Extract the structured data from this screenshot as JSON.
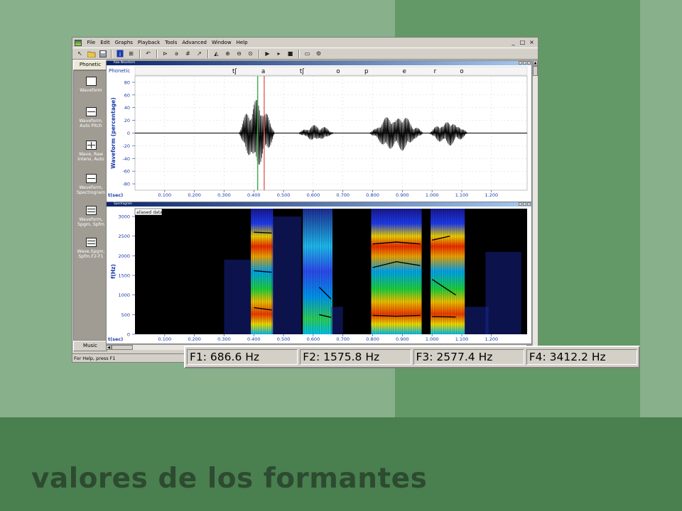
{
  "slide": {
    "caption": "valores de los formantes"
  },
  "app": {
    "menu": [
      "File",
      "Edit",
      "Graphs",
      "Playback",
      "Tools",
      "Advanced",
      "Window",
      "Help"
    ],
    "window_controls": [
      "_",
      "□",
      "×"
    ],
    "status_text": "For Help, press F1"
  },
  "sidebar": {
    "top_tab": "Phonetic",
    "bottom_tab": "Music",
    "layouts": [
      {
        "label": "Waveform"
      },
      {
        "label": "Waveform, Auto Pitch"
      },
      {
        "label": "Wave, Raw Intens, Auto"
      },
      {
        "label": "Waveform, Spectrogram"
      },
      {
        "label": "Waveform, Spgm, Spfm"
      },
      {
        "label": "Wave,Spgm, Spfm,F2-F1"
      }
    ]
  },
  "waveform_panel": {
    "window_title": "Raw Waveform",
    "tier_label": "Phonetic",
    "phonetic_symbols": [
      {
        "t": 0.335,
        "s": "tʃ"
      },
      {
        "t": 0.432,
        "s": "a"
      },
      {
        "t": 0.562,
        "s": "tʃ"
      },
      {
        "t": 0.684,
        "s": "o"
      },
      {
        "t": 0.779,
        "s": "p"
      },
      {
        "t": 0.907,
        "s": "e"
      },
      {
        "t": 1.01,
        "s": "r"
      },
      {
        "t": 1.1,
        "s": "o"
      }
    ],
    "cursor_green_t": 0.413,
    "cursor_red_t": 0.435
  },
  "spectrogram_panel": {
    "window_title": "Spectrogram",
    "overlay_label": "aliased data"
  },
  "formants": [
    {
      "label": "F1: 686.6 Hz",
      "hz": 686.6
    },
    {
      "label": "F2: 1575.8 Hz",
      "hz": 1575.8
    },
    {
      "label": "F3: 2577.4 Hz",
      "hz": 2577.4
    },
    {
      "label": "F4: 3412.2 Hz",
      "hz": 3412.2
    }
  ],
  "chart_data": [
    {
      "type": "line",
      "ylabel": "Waveform (percentage)",
      "xlabel": "t(sec)",
      "ylim": [
        -90,
        90
      ],
      "xlim": [
        0.0,
        1.32
      ],
      "y_ticks": [
        80,
        60,
        40,
        20,
        0,
        -20,
        -40,
        -60,
        -80
      ],
      "x_ticks": [
        "0.100",
        "0.200",
        "0.300",
        "0.400",
        "0.500",
        "0.600",
        "0.700",
        "0.800",
        "0.900",
        "1.000",
        "1.100",
        "1.200"
      ],
      "grid": true,
      "series": [
        {
          "segments": [
            {
              "t0": 0.35,
              "t1": 0.47,
              "amp": 55
            },
            {
              "t0": 0.55,
              "t1": 0.67,
              "amp": 13
            },
            {
              "t0": 0.79,
              "t1": 0.97,
              "amp": 30
            },
            {
              "t0": 0.99,
              "t1": 1.12,
              "amp": 20
            }
          ]
        }
      ]
    },
    {
      "type": "heatmap",
      "ylabel": "f(Hz)",
      "xlabel": "t(sec)",
      "ylim": [
        0,
        3200
      ],
      "xlim": [
        0.0,
        1.32
      ],
      "y_ticks": [
        3000,
        2500,
        2000,
        1500,
        1000,
        500,
        0
      ],
      "x_ticks": [
        "0.100",
        "0.200",
        "0.300",
        "0.400",
        "0.500",
        "0.600",
        "0.700",
        "0.800",
        "0.900",
        "1.000",
        "1.100",
        "1.200"
      ],
      "energy_regions": [
        {
          "t0": 0.39,
          "t1": 0.465,
          "f0": 0,
          "f1": 3200
        },
        {
          "t0": 0.565,
          "t1": 0.665,
          "f0": 0,
          "f1": 3200
        },
        {
          "t0": 0.795,
          "t1": 0.965,
          "f0": 0,
          "f1": 3200
        },
        {
          "t0": 0.995,
          "t1": 1.11,
          "f0": 0,
          "f1": 3200
        }
      ],
      "formant_tracks": [
        {
          "points": [
            [
              0.4,
              2600
            ],
            [
              0.46,
              2580
            ]
          ]
        },
        {
          "points": [
            [
              0.4,
              1620
            ],
            [
              0.46,
              1580
            ]
          ]
        },
        {
          "points": [
            [
              0.4,
              680
            ],
            [
              0.46,
              620
            ]
          ]
        },
        {
          "points": [
            [
              0.62,
              1200
            ],
            [
              0.66,
              900
            ]
          ]
        },
        {
          "points": [
            [
              0.62,
              500
            ],
            [
              0.66,
              430
            ]
          ]
        },
        {
          "points": [
            [
              0.8,
              2300
            ],
            [
              0.88,
              2350
            ],
            [
              0.96,
              2300
            ]
          ]
        },
        {
          "points": [
            [
              0.8,
              1700
            ],
            [
              0.88,
              1850
            ],
            [
              0.96,
              1750
            ]
          ]
        },
        {
          "points": [
            [
              0.8,
              480
            ],
            [
              0.88,
              460
            ],
            [
              0.96,
              480
            ]
          ]
        },
        {
          "points": [
            [
              1.0,
              2400
            ],
            [
              1.06,
              2500
            ]
          ]
        },
        {
          "points": [
            [
              1.0,
              1400
            ],
            [
              1.08,
              1000
            ]
          ]
        },
        {
          "points": [
            [
              1.0,
              450
            ],
            [
              1.08,
              440
            ]
          ]
        }
      ]
    }
  ]
}
